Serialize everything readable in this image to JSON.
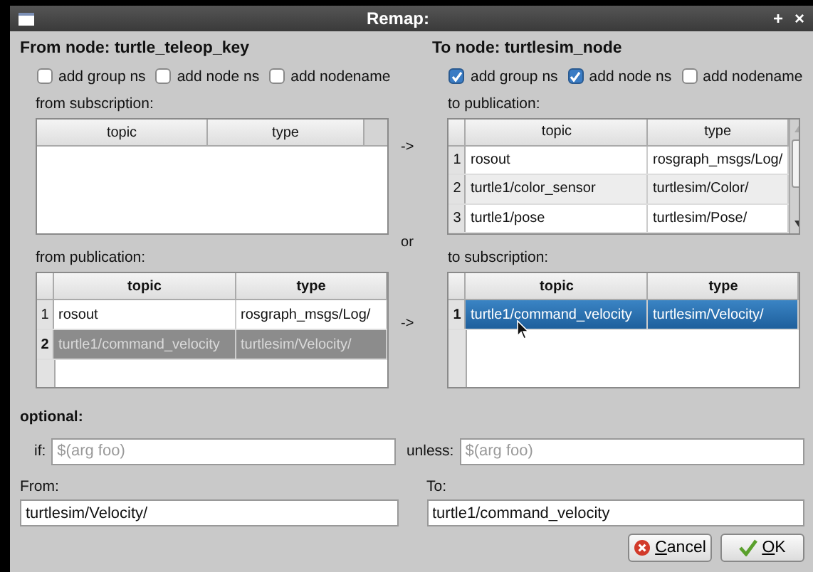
{
  "window": {
    "title": "Remap:",
    "controls": [
      "+",
      "×"
    ]
  },
  "from_node": {
    "title": "From node: turtle_teleop_key",
    "options": [
      {
        "label": "add group ns",
        "checked": false
      },
      {
        "label": "add node ns",
        "checked": false
      },
      {
        "label": "add nodename",
        "checked": false
      }
    ],
    "subscription": {
      "label": "from subscription:",
      "scrollbar": false,
      "columns": [
        "topic",
        "type"
      ]
    },
    "publication": {
      "label": "from publication:",
      "focused": false,
      "scrollbar": false,
      "columns": [
        "topic",
        "type"
      ],
      "rows": [
        {
          "number": "1",
          "topic": "rosout",
          "type": "rosgraph_msgs/Log/",
          "selected": false
        },
        {
          "number": "2",
          "topic": "turtle1/command_velocity",
          "type": "turtlesim/Velocity/",
          "selected": true
        }
      ]
    }
  },
  "connectors": [
    "->",
    "or",
    "->"
  ],
  "to_node": {
    "title": "To node: turtlesim_node",
    "options": [
      {
        "label": "add group ns",
        "checked": true
      },
      {
        "label": "add node ns",
        "checked": true
      },
      {
        "label": "add nodename",
        "checked": false
      }
    ],
    "publication": {
      "label": "to publication:",
      "scrollbar": true,
      "columns": [
        "topic",
        "type"
      ],
      "rows": [
        {
          "number": "1",
          "topic": "rosout",
          "type": "rosgraph_msgs/Log/",
          "selected": false
        },
        {
          "number": "2",
          "topic": "turtle1/color_sensor",
          "type": "turtlesim/Color/",
          "selected": false
        },
        {
          "number": "3",
          "topic": "turtle1/pose",
          "type": "turtlesim/Pose/",
          "selected": false
        }
      ]
    },
    "subscription": {
      "label": "to subscription:",
      "focused": true,
      "scrollbar": false,
      "columns": [
        "topic",
        "type"
      ],
      "rows": [
        {
          "number": "1",
          "topic": "turtle1/command_velocity",
          "type": "turtlesim/Velocity/",
          "selected": true
        }
      ]
    }
  },
  "optional": {
    "label": "optional:",
    "if": {
      "label": "if:",
      "placeholder": "$(arg foo)"
    },
    "unless": {
      "label": "unless:",
      "placeholder": "$(arg foo)"
    }
  },
  "from": {
    "label": "From:",
    "value": "turtlesim/Velocity/"
  },
  "to": {
    "label": "To:",
    "value": "turtle1/command_velocity"
  },
  "buttons": [
    {
      "label": "Cancel",
      "kind": "cancel"
    },
    {
      "label": "OK",
      "kind": "ok"
    }
  ]
}
